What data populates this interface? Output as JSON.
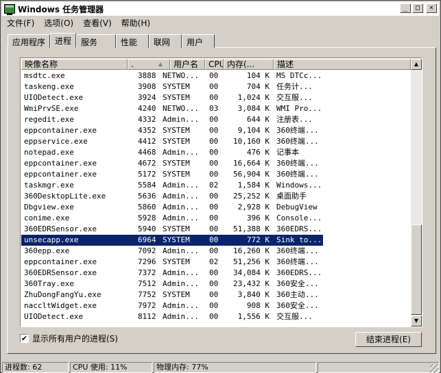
{
  "window": {
    "title": "Windows 任务管理器",
    "buttons": {
      "minimize": "_",
      "maximize": "□",
      "close": "×"
    }
  },
  "menu": [
    {
      "label": "文件(F)"
    },
    {
      "label": "选项(O)"
    },
    {
      "label": "查看(V)"
    },
    {
      "label": "帮助(H)"
    }
  ],
  "tabs": [
    {
      "label": "应用程序",
      "active": false
    },
    {
      "label": "进程",
      "active": true
    },
    {
      "label": "服务",
      "active": false
    },
    {
      "label": "性能",
      "active": false
    },
    {
      "label": "联网",
      "active": false
    },
    {
      "label": "用户",
      "active": false
    }
  ],
  "table": {
    "columns": [
      "映像名称",
      ".",
      "用户名",
      "CPU",
      "内存(...",
      "描述"
    ],
    "rows": [
      {
        "name": "msdtc.exe",
        "pid": "3888",
        "user": "NETWO...",
        "cpu": "00",
        "mem": "104 K",
        "desc": "MS DTCc..."
      },
      {
        "name": "taskeng.exe",
        "pid": "3908",
        "user": "SYSTEM",
        "cpu": "00",
        "mem": "704 K",
        "desc": "任务计..."
      },
      {
        "name": "UIODetect.exe",
        "pid": "3924",
        "user": "SYSTEM",
        "cpu": "00",
        "mem": "1,024 K",
        "desc": "交互服..."
      },
      {
        "name": "WmiPrvSE.exe",
        "pid": "4240",
        "user": "NETWO...",
        "cpu": "03",
        "mem": "3,084 K",
        "desc": "WMI Pro..."
      },
      {
        "name": "regedit.exe",
        "pid": "4332",
        "user": "Admin...",
        "cpu": "00",
        "mem": "644 K",
        "desc": "注册表..."
      },
      {
        "name": "eppcontainer.exe",
        "pid": "4352",
        "user": "SYSTEM",
        "cpu": "00",
        "mem": "9,104 K",
        "desc": "360终端..."
      },
      {
        "name": "eppservice.exe",
        "pid": "4412",
        "user": "SYSTEM",
        "cpu": "00",
        "mem": "10,160 K",
        "desc": "360终端..."
      },
      {
        "name": "notepad.exe",
        "pid": "4468",
        "user": "Admin...",
        "cpu": "00",
        "mem": "476 K",
        "desc": "记事本"
      },
      {
        "name": "eppcontainer.exe",
        "pid": "4672",
        "user": "SYSTEM",
        "cpu": "00",
        "mem": "16,664 K",
        "desc": "360终端..."
      },
      {
        "name": "eppcontainer.exe",
        "pid": "5172",
        "user": "SYSTEM",
        "cpu": "00",
        "mem": "56,904 K",
        "desc": "360终端..."
      },
      {
        "name": "taskmgr.exe",
        "pid": "5584",
        "user": "Admin...",
        "cpu": "02",
        "mem": "1,584 K",
        "desc": "Windows..."
      },
      {
        "name": "360DesktopLite.exe",
        "pid": "5636",
        "user": "Admin...",
        "cpu": "00",
        "mem": "25,252 K",
        "desc": "桌面助手"
      },
      {
        "name": "Dbgview.exe",
        "pid": "5860",
        "user": "Admin...",
        "cpu": "00",
        "mem": "2,928 K",
        "desc": "DebugView"
      },
      {
        "name": "conime.exe",
        "pid": "5928",
        "user": "Admin...",
        "cpu": "00",
        "mem": "396 K",
        "desc": "Console..."
      },
      {
        "name": "360EDRSensor.exe",
        "pid": "5940",
        "user": "SYSTEM",
        "cpu": "00",
        "mem": "51,388 K",
        "desc": "360EDRS..."
      },
      {
        "name": "unsecapp.exe",
        "pid": "6964",
        "user": "SYSTEM",
        "cpu": "00",
        "mem": "772 K",
        "desc": "Sink to...",
        "selected": true
      },
      {
        "name": "360epp.exe",
        "pid": "7092",
        "user": "Admin...",
        "cpu": "00",
        "mem": "16,260 K",
        "desc": "360终端..."
      },
      {
        "name": "eppcontainer.exe",
        "pid": "7296",
        "user": "SYSTEM",
        "cpu": "02",
        "mem": "51,256 K",
        "desc": "360终端..."
      },
      {
        "name": "360EDRSensor.exe",
        "pid": "7372",
        "user": "Admin...",
        "cpu": "00",
        "mem": "34,084 K",
        "desc": "360EDRS..."
      },
      {
        "name": "360Tray.exe",
        "pid": "7512",
        "user": "Admin...",
        "cpu": "00",
        "mem": "23,432 K",
        "desc": "360安全..."
      },
      {
        "name": "ZhuDongFangYu.exe",
        "pid": "7752",
        "user": "SYSTEM",
        "cpu": "00",
        "mem": "3,840 K",
        "desc": "360主动..."
      },
      {
        "name": "naccltWidget.exe",
        "pid": "7972",
        "user": "Admin...",
        "cpu": "00",
        "mem": "908 K",
        "desc": "360安全..."
      },
      {
        "name": "UIODetect.exe",
        "pid": "8112",
        "user": "Admin...",
        "cpu": "00",
        "mem": "1,556 K",
        "desc": "交互服..."
      }
    ]
  },
  "show_all_users": {
    "label": "显示所有用户的进程(S)",
    "checked": true,
    "check_glyph": "✔"
  },
  "end_process_button": "结束进程(E)",
  "statusbar": {
    "process_count": "进程数: 62",
    "cpu_usage": "CPU 使用: 11%",
    "memory": "物理内存: 77%"
  }
}
